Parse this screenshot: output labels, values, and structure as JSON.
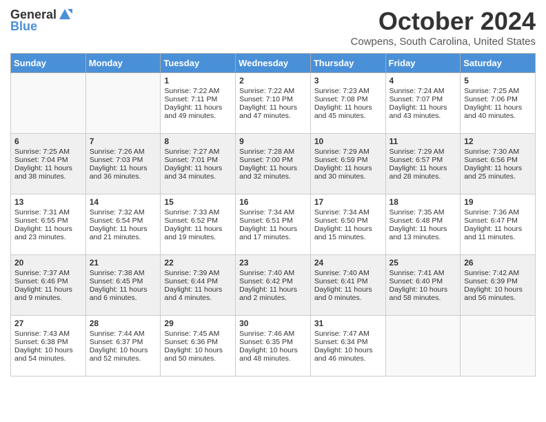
{
  "header": {
    "logo_general": "General",
    "logo_blue": "Blue",
    "month": "October 2024",
    "location": "Cowpens, South Carolina, United States"
  },
  "days_of_week": [
    "Sunday",
    "Monday",
    "Tuesday",
    "Wednesday",
    "Thursday",
    "Friday",
    "Saturday"
  ],
  "weeks": [
    [
      {
        "day": "",
        "sunrise": "",
        "sunset": "",
        "daylight": ""
      },
      {
        "day": "",
        "sunrise": "",
        "sunset": "",
        "daylight": ""
      },
      {
        "day": "1",
        "sunrise": "Sunrise: 7:22 AM",
        "sunset": "Sunset: 7:11 PM",
        "daylight": "Daylight: 11 hours and 49 minutes."
      },
      {
        "day": "2",
        "sunrise": "Sunrise: 7:22 AM",
        "sunset": "Sunset: 7:10 PM",
        "daylight": "Daylight: 11 hours and 47 minutes."
      },
      {
        "day": "3",
        "sunrise": "Sunrise: 7:23 AM",
        "sunset": "Sunset: 7:08 PM",
        "daylight": "Daylight: 11 hours and 45 minutes."
      },
      {
        "day": "4",
        "sunrise": "Sunrise: 7:24 AM",
        "sunset": "Sunset: 7:07 PM",
        "daylight": "Daylight: 11 hours and 43 minutes."
      },
      {
        "day": "5",
        "sunrise": "Sunrise: 7:25 AM",
        "sunset": "Sunset: 7:06 PM",
        "daylight": "Daylight: 11 hours and 40 minutes."
      }
    ],
    [
      {
        "day": "6",
        "sunrise": "Sunrise: 7:25 AM",
        "sunset": "Sunset: 7:04 PM",
        "daylight": "Daylight: 11 hours and 38 minutes."
      },
      {
        "day": "7",
        "sunrise": "Sunrise: 7:26 AM",
        "sunset": "Sunset: 7:03 PM",
        "daylight": "Daylight: 11 hours and 36 minutes."
      },
      {
        "day": "8",
        "sunrise": "Sunrise: 7:27 AM",
        "sunset": "Sunset: 7:01 PM",
        "daylight": "Daylight: 11 hours and 34 minutes."
      },
      {
        "day": "9",
        "sunrise": "Sunrise: 7:28 AM",
        "sunset": "Sunset: 7:00 PM",
        "daylight": "Daylight: 11 hours and 32 minutes."
      },
      {
        "day": "10",
        "sunrise": "Sunrise: 7:29 AM",
        "sunset": "Sunset: 6:59 PM",
        "daylight": "Daylight: 11 hours and 30 minutes."
      },
      {
        "day": "11",
        "sunrise": "Sunrise: 7:29 AM",
        "sunset": "Sunset: 6:57 PM",
        "daylight": "Daylight: 11 hours and 28 minutes."
      },
      {
        "day": "12",
        "sunrise": "Sunrise: 7:30 AM",
        "sunset": "Sunset: 6:56 PM",
        "daylight": "Daylight: 11 hours and 25 minutes."
      }
    ],
    [
      {
        "day": "13",
        "sunrise": "Sunrise: 7:31 AM",
        "sunset": "Sunset: 6:55 PM",
        "daylight": "Daylight: 11 hours and 23 minutes."
      },
      {
        "day": "14",
        "sunrise": "Sunrise: 7:32 AM",
        "sunset": "Sunset: 6:54 PM",
        "daylight": "Daylight: 11 hours and 21 minutes."
      },
      {
        "day": "15",
        "sunrise": "Sunrise: 7:33 AM",
        "sunset": "Sunset: 6:52 PM",
        "daylight": "Daylight: 11 hours and 19 minutes."
      },
      {
        "day": "16",
        "sunrise": "Sunrise: 7:34 AM",
        "sunset": "Sunset: 6:51 PM",
        "daylight": "Daylight: 11 hours and 17 minutes."
      },
      {
        "day": "17",
        "sunrise": "Sunrise: 7:34 AM",
        "sunset": "Sunset: 6:50 PM",
        "daylight": "Daylight: 11 hours and 15 minutes."
      },
      {
        "day": "18",
        "sunrise": "Sunrise: 7:35 AM",
        "sunset": "Sunset: 6:48 PM",
        "daylight": "Daylight: 11 hours and 13 minutes."
      },
      {
        "day": "19",
        "sunrise": "Sunrise: 7:36 AM",
        "sunset": "Sunset: 6:47 PM",
        "daylight": "Daylight: 11 hours and 11 minutes."
      }
    ],
    [
      {
        "day": "20",
        "sunrise": "Sunrise: 7:37 AM",
        "sunset": "Sunset: 6:46 PM",
        "daylight": "Daylight: 11 hours and 9 minutes."
      },
      {
        "day": "21",
        "sunrise": "Sunrise: 7:38 AM",
        "sunset": "Sunset: 6:45 PM",
        "daylight": "Daylight: 11 hours and 6 minutes."
      },
      {
        "day": "22",
        "sunrise": "Sunrise: 7:39 AM",
        "sunset": "Sunset: 6:44 PM",
        "daylight": "Daylight: 11 hours and 4 minutes."
      },
      {
        "day": "23",
        "sunrise": "Sunrise: 7:40 AM",
        "sunset": "Sunset: 6:42 PM",
        "daylight": "Daylight: 11 hours and 2 minutes."
      },
      {
        "day": "24",
        "sunrise": "Sunrise: 7:40 AM",
        "sunset": "Sunset: 6:41 PM",
        "daylight": "Daylight: 11 hours and 0 minutes."
      },
      {
        "day": "25",
        "sunrise": "Sunrise: 7:41 AM",
        "sunset": "Sunset: 6:40 PM",
        "daylight": "Daylight: 10 hours and 58 minutes."
      },
      {
        "day": "26",
        "sunrise": "Sunrise: 7:42 AM",
        "sunset": "Sunset: 6:39 PM",
        "daylight": "Daylight: 10 hours and 56 minutes."
      }
    ],
    [
      {
        "day": "27",
        "sunrise": "Sunrise: 7:43 AM",
        "sunset": "Sunset: 6:38 PM",
        "daylight": "Daylight: 10 hours and 54 minutes."
      },
      {
        "day": "28",
        "sunrise": "Sunrise: 7:44 AM",
        "sunset": "Sunset: 6:37 PM",
        "daylight": "Daylight: 10 hours and 52 minutes."
      },
      {
        "day": "29",
        "sunrise": "Sunrise: 7:45 AM",
        "sunset": "Sunset: 6:36 PM",
        "daylight": "Daylight: 10 hours and 50 minutes."
      },
      {
        "day": "30",
        "sunrise": "Sunrise: 7:46 AM",
        "sunset": "Sunset: 6:35 PM",
        "daylight": "Daylight: 10 hours and 48 minutes."
      },
      {
        "day": "31",
        "sunrise": "Sunrise: 7:47 AM",
        "sunset": "Sunset: 6:34 PM",
        "daylight": "Daylight: 10 hours and 46 minutes."
      },
      {
        "day": "",
        "sunrise": "",
        "sunset": "",
        "daylight": ""
      },
      {
        "day": "",
        "sunrise": "",
        "sunset": "",
        "daylight": ""
      }
    ]
  ]
}
